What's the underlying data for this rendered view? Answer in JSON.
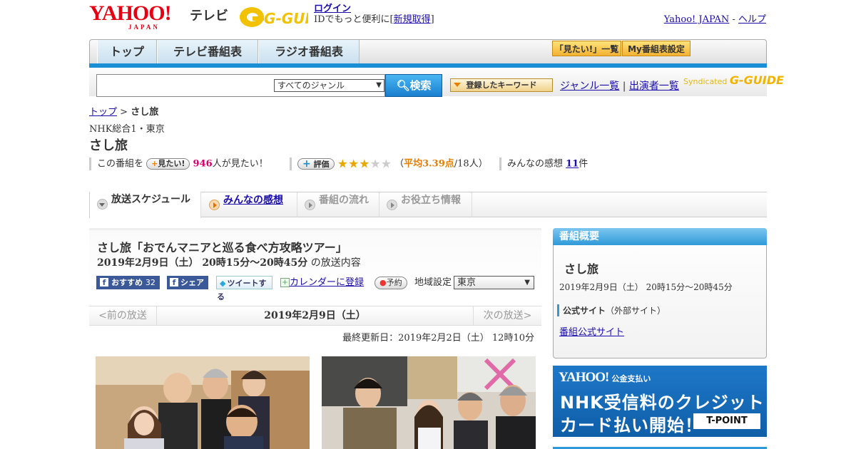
{
  "header": {
    "yahoo_logo": "YAHOO!",
    "yahoo_logo_sub": "JAPAN",
    "tv_label": "テレビ",
    "gguide_logo": "G-GUIDE",
    "login_link": "ログイン",
    "login_text": "IDでもっと便利に[",
    "signup_link": "新規取得",
    "signup_close": "]",
    "yahoo_japan_link": "Yahoo! JAPAN",
    "separator": " - ",
    "help_link": "ヘルプ"
  },
  "nav": {
    "tabs": [
      "トップ",
      "テレビ番組表",
      "ラジオ番組表"
    ],
    "want_list": "「見たい!」一覧",
    "my_schedule": "My番組表設定"
  },
  "search": {
    "genre_selected": "すべてのジャンル",
    "search_button": "検索",
    "keyword_button": "登録したキーワード",
    "genre_list": "ジャンル一覧",
    "divider": "|",
    "performer_list": "出演者一覧",
    "syndicated": "Syndicated",
    "syndicated_logo": "G-GUIDE"
  },
  "breadcrumb": {
    "top": "トップ",
    "sep": " > ",
    "current": "さし旅"
  },
  "program": {
    "station": "NHK総合1・東京",
    "title": "さし旅",
    "want_prefix": "この番組を",
    "want_button": "見たい!",
    "want_count": "946",
    "want_suffix": "人が見たい！",
    "rating_button": "評価",
    "rating_value": 3,
    "rating_open": "（",
    "rating_avg": "平均3.39点",
    "rating_count": "/18人）",
    "reviews_prefix": "みんなの感想",
    "reviews_count": "11",
    "reviews_suffix": "件"
  },
  "content_tabs": [
    "放送スケジュール",
    "みんなの感想",
    "番組の流れ",
    "お役立ち情報"
  ],
  "episode": {
    "title": "さし旅「おでんマニアと巡る食べ方攻略ツアー」",
    "datetime": "2019年2月9日（土） 20時15分～20時45分",
    "datetime_suffix": "の放送内容",
    "recommend_label": "おすすめ",
    "recommend_count": "32",
    "share_label": "シェア",
    "tweet_label": "ツイートする",
    "calendar_link": "カレンダーに登録",
    "reserve_button": "予約",
    "region_label": "地域設定",
    "region_value": "東京",
    "prev": "<前の放送",
    "current_date": "2019年2月9日（土）",
    "next": "次の放送>",
    "updated": "最終更新日：2019年2月2日（土） 12時10分"
  },
  "sidebar": {
    "header": "番組概要",
    "title": "さし旅",
    "date": "2019年2月9日（土） 20時15分～20時45分",
    "official_label": "公式サイト",
    "official_note": "（外部サイト）",
    "official_link": "番組公式サイト"
  },
  "ad": {
    "brand": "YAHOO!",
    "brand_sub": "公金支払い",
    "line1": "NHK受信料のクレジット",
    "line2": "カード払い開始！",
    "tpoint": "T-POINT"
  }
}
